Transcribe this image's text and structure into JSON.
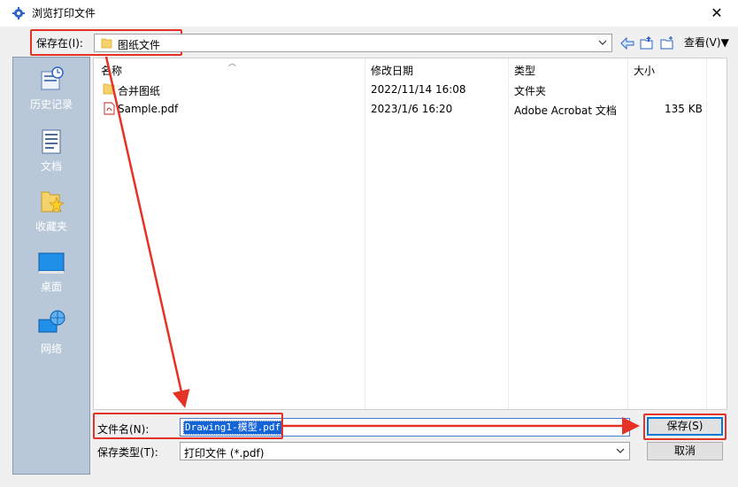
{
  "window": {
    "title": "浏览打印文件",
    "close_glyph": "✕"
  },
  "toolbar": {
    "save_in_label": "保存在(I):",
    "location": "图纸文件",
    "view_label": "查看(V)",
    "view_arrow": "▼"
  },
  "places": [
    {
      "label": "历史记录",
      "icon": "history-icon"
    },
    {
      "label": "文档",
      "icon": "document-icon"
    },
    {
      "label": "收藏夹",
      "icon": "favorites-icon"
    },
    {
      "label": "桌面",
      "icon": "desktop-icon"
    },
    {
      "label": "网络",
      "icon": "network-icon"
    }
  ],
  "columns": {
    "name": "名称",
    "modified": "修改日期",
    "type": "类型",
    "size": "大小"
  },
  "files": [
    {
      "name": "合并图纸",
      "modified": "2022/11/14 16:08",
      "type": "文件夹",
      "size": "",
      "icon": "folder-icon"
    },
    {
      "name": "Sample.pdf",
      "modified": "2023/1/6 16:20",
      "type": "Adobe Acrobat 文档",
      "size": "135 KB",
      "icon": "pdf-icon"
    }
  ],
  "bottom": {
    "filename_label": "文件名(N):",
    "filename_value": "Drawing1-模型.pdf",
    "filetype_label": "保存类型(T):",
    "filetype_value": "打印文件 (*.pdf)",
    "save_button": "保存(S)",
    "cancel_button": "取消"
  },
  "colors": {
    "annotation": "#e53226",
    "selection": "#1463d7",
    "places_bg": "#b8c8d9"
  }
}
